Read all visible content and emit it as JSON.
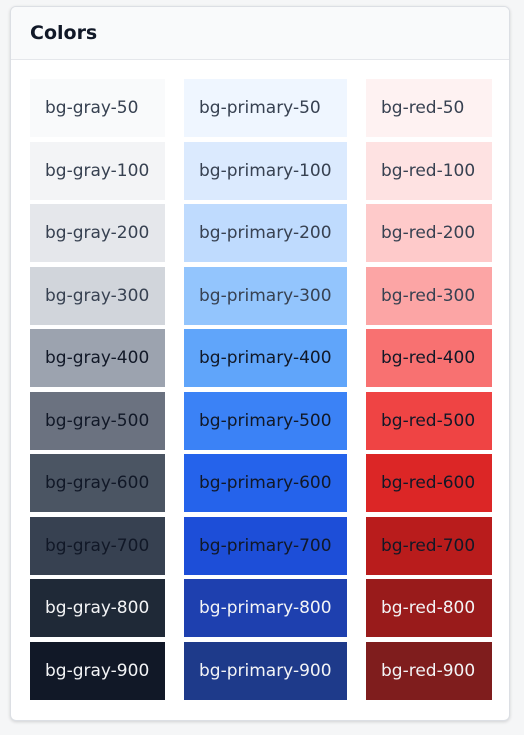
{
  "card": {
    "title": "Colors"
  },
  "columns": [
    {
      "id": "gray",
      "swatches": [
        {
          "label": "bg-gray-50",
          "bg": "#f9fafb",
          "fg": "#374151"
        },
        {
          "label": "bg-gray-100",
          "bg": "#f3f4f6",
          "fg": "#374151"
        },
        {
          "label": "bg-gray-200",
          "bg": "#e5e7eb",
          "fg": "#374151"
        },
        {
          "label": "bg-gray-300",
          "bg": "#d1d5db",
          "fg": "#374151"
        },
        {
          "label": "bg-gray-400",
          "bg": "#9ca3af",
          "fg": "#111827"
        },
        {
          "label": "bg-gray-500",
          "bg": "#6b7280",
          "fg": "#111827"
        },
        {
          "label": "bg-gray-600",
          "bg": "#4b5563",
          "fg": "#111827"
        },
        {
          "label": "bg-gray-700",
          "bg": "#374151",
          "fg": "#111827"
        },
        {
          "label": "bg-gray-800",
          "bg": "#1f2937",
          "fg": "#f3f4f6"
        },
        {
          "label": "bg-gray-900",
          "bg": "#111827",
          "fg": "#f3f4f6"
        }
      ]
    },
    {
      "id": "primary",
      "swatches": [
        {
          "label": "bg-primary-50",
          "bg": "#eff6ff",
          "fg": "#374151"
        },
        {
          "label": "bg-primary-100",
          "bg": "#dbeafe",
          "fg": "#374151"
        },
        {
          "label": "bg-primary-200",
          "bg": "#bfdbfe",
          "fg": "#374151"
        },
        {
          "label": "bg-primary-300",
          "bg": "#93c5fd",
          "fg": "#374151"
        },
        {
          "label": "bg-primary-400",
          "bg": "#60a5fa",
          "fg": "#111827"
        },
        {
          "label": "bg-primary-500",
          "bg": "#3b82f6",
          "fg": "#111827"
        },
        {
          "label": "bg-primary-600",
          "bg": "#2563eb",
          "fg": "#111827"
        },
        {
          "label": "bg-primary-700",
          "bg": "#1d4ed8",
          "fg": "#111827"
        },
        {
          "label": "bg-primary-800",
          "bg": "#1e40af",
          "fg": "#f3f4f6"
        },
        {
          "label": "bg-primary-900",
          "bg": "#1e3a8a",
          "fg": "#f3f4f6"
        }
      ]
    },
    {
      "id": "red",
      "swatches": [
        {
          "label": "bg-red-50",
          "bg": "#fef2f2",
          "fg": "#374151"
        },
        {
          "label": "bg-red-100",
          "bg": "#fee2e2",
          "fg": "#374151"
        },
        {
          "label": "bg-red-200",
          "bg": "#fecaca",
          "fg": "#374151"
        },
        {
          "label": "bg-red-300",
          "bg": "#fca5a5",
          "fg": "#374151"
        },
        {
          "label": "bg-red-400",
          "bg": "#f87171",
          "fg": "#111827"
        },
        {
          "label": "bg-red-500",
          "bg": "#ef4444",
          "fg": "#111827"
        },
        {
          "label": "bg-red-600",
          "bg": "#dc2626",
          "fg": "#111827"
        },
        {
          "label": "bg-red-700",
          "bg": "#b91c1c",
          "fg": "#111827"
        },
        {
          "label": "bg-red-800",
          "bg": "#991b1b",
          "fg": "#f3f4f6"
        },
        {
          "label": "bg-red-900",
          "bg": "#7f1d1d",
          "fg": "#f3f4f6"
        }
      ]
    }
  ]
}
